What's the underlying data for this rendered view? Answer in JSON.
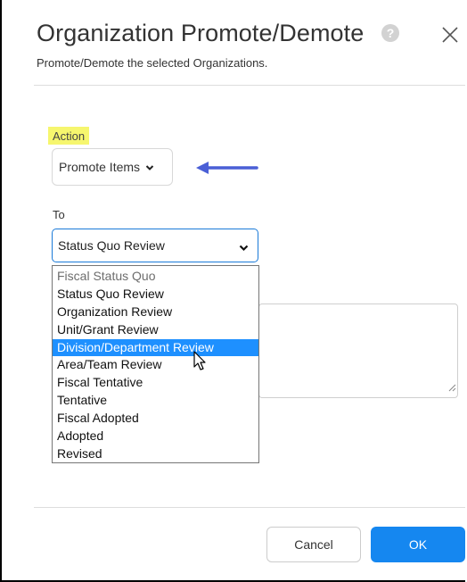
{
  "dialog": {
    "title": "Organization Promote/Demote",
    "subtitle": "Promote/Demote the selected Organizations.",
    "help_glyph": "?",
    "help_icon": "question-circle-icon",
    "close_icon": "close-icon"
  },
  "action": {
    "label": "Action",
    "selected": "Promote Items"
  },
  "to": {
    "label": "To",
    "selected": "Status Quo Review",
    "options": [
      "Fiscal Status Quo",
      "Status Quo Review",
      "Organization Review",
      "Unit/Grant Review",
      "Division/Department Review",
      "Area/Team Review",
      "Fiscal Tentative",
      "Tentative",
      "Fiscal Adopted",
      "Adopted",
      "Revised"
    ],
    "highlighted_option": "Division/Department Review",
    "disabled_option": "Fiscal Status Quo"
  },
  "buttons": {
    "cancel": "Cancel",
    "ok": "OK"
  },
  "colors": {
    "highlight": "#f6f66e",
    "primary": "#1587f0",
    "focus_border": "#1a7ad8",
    "option_hover": "#1e90ff",
    "arrow": "#4a5fd6"
  }
}
